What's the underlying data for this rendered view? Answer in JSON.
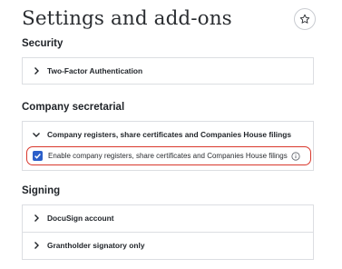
{
  "page": {
    "title": "Settings and add-ons",
    "favorite_icon": "star-outline-icon"
  },
  "sections": {
    "security": {
      "title": "Security",
      "items": [
        {
          "label": "Two-Factor Authentication",
          "expanded": false
        }
      ]
    },
    "company_secretarial": {
      "title": "Company secretarial",
      "items": [
        {
          "label": "Company registers, share certificates and Companies House filings",
          "expanded": true,
          "option": {
            "label": "Enable company registers, share certificates and Companies House filings",
            "checked": true,
            "info_icon": "info-circle-icon"
          }
        }
      ]
    },
    "signing": {
      "title": "Signing",
      "items": [
        {
          "label": "DocuSign account",
          "expanded": false
        },
        {
          "label": "Grantholder signatory only",
          "expanded": false
        }
      ]
    }
  },
  "colors": {
    "accent": "#2b5ec9",
    "highlight": "#d9382d",
    "border": "#dcdee2"
  }
}
